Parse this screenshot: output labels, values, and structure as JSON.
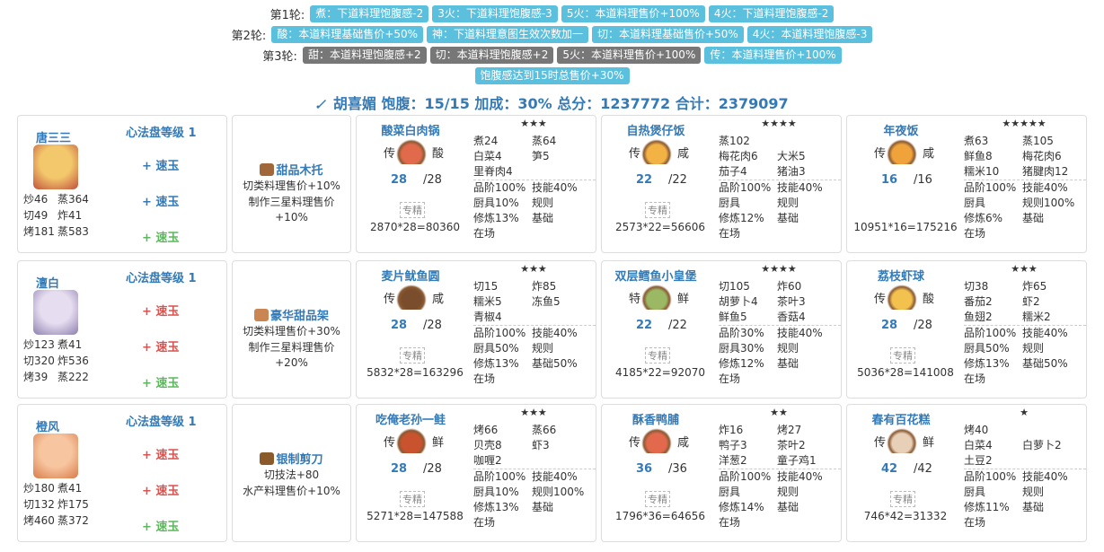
{
  "rounds": [
    {
      "label": "第1轮:",
      "tags": [
        {
          "text": "煮：下道料理饱腹感-2",
          "color": "blue"
        },
        {
          "text": "3火：下道料理饱腹感-3",
          "color": "blue"
        },
        {
          "text": "5火：本道料理售价+100%",
          "color": "blue"
        },
        {
          "text": "4火：下道料理饱腹感-2",
          "color": "blue"
        }
      ]
    },
    {
      "label": "第2轮:",
      "tags": [
        {
          "text": "酸：本道料理基础售价+50%",
          "color": "blue"
        },
        {
          "text": "神：下道料理意图生效次数加一",
          "color": "blue"
        },
        {
          "text": "切：本道料理基础售价+50%",
          "color": "blue"
        },
        {
          "text": "4火：本道料理饱腹感-3",
          "color": "blue"
        }
      ]
    },
    {
      "label": "第3轮:",
      "tags": [
        {
          "text": "甜：本道料理饱腹感+2",
          "color": "gray"
        },
        {
          "text": "切：本道料理饱腹感+2",
          "color": "gray"
        },
        {
          "text": "5火：本道料理售价+100%",
          "color": "gray"
        },
        {
          "text": "传：本道料理售价+100%",
          "color": "blue"
        }
      ]
    },
    {
      "label": "",
      "tags": [
        {
          "text": "饱腹感达到15时总售价+30%",
          "color": "blue"
        }
      ]
    }
  ],
  "summary": {
    "text": "胡喜媚 饱腹：15/15 加成：30% 总分：1237772 合计：2379097"
  },
  "rows": [
    {
      "chef": {
        "name": "唐三三",
        "xinfa": "心法盘等级 1",
        "stats": [
          "炒46",
          "蒸364",
          "切49",
          "炸41",
          "烤181",
          "蒸583"
        ],
        "yu": [
          {
            "text": "+ 速玉",
            "color": "blue"
          },
          {
            "text": "+ 速玉",
            "color": "blue"
          },
          {
            "text": "+ 速玉",
            "color": "green"
          }
        ]
      },
      "equip": {
        "name": "甜品木托",
        "effects": [
          "切类料理售价+10%",
          "制作三星料理售价+10%"
        ]
      },
      "dishes": [
        {
          "name": "酸菜白肉锅",
          "stars": "★★★",
          "source": "传",
          "taste": "酸",
          "qty": "28",
          "max": "/28",
          "note": "专精",
          "total": "2870*28=80360",
          "ingredients": [
            [
              "煮24",
              "蒸64"
            ],
            [
              "白菜4",
              "笋5"
            ],
            [
              "里脊肉4",
              ""
            ]
          ],
          "attrs": [
            [
              "品阶100%",
              "技能40%"
            ],
            [
              "厨具10%",
              "规则"
            ],
            [
              "修炼13%",
              "基础"
            ],
            [
              "在场",
              ""
            ]
          ]
        },
        {
          "name": "自热煲仔饭",
          "stars": "★★★★",
          "source": "传",
          "taste": "咸",
          "qty": "22",
          "max": "/22",
          "note": "专精",
          "total": "2573*22=56606",
          "ingredients": [
            [
              "蒸102",
              ""
            ],
            [
              "梅花肉6",
              "大米5"
            ],
            [
              "茄子4",
              "猪油3"
            ]
          ],
          "attrs": [
            [
              "品阶100%",
              "技能40%"
            ],
            [
              "厨具",
              "规则"
            ],
            [
              "修炼12%",
              "基础"
            ],
            [
              "在场",
              ""
            ]
          ]
        },
        {
          "name": "年夜饭",
          "stars": "★★★★★",
          "source": "传",
          "taste": "咸",
          "qty": "16",
          "max": "/16",
          "note": "",
          "total": "10951*16=175216",
          "ingredients": [
            [
              "煮63",
              "蒸105"
            ],
            [
              "鲜鱼8",
              "梅花肉6"
            ],
            [
              "糯米10",
              "猪腱肉12"
            ]
          ],
          "attrs": [
            [
              "品阶100%",
              "技能40%"
            ],
            [
              "厨具",
              "规则100%"
            ],
            [
              "修炼6%",
              "基础"
            ],
            [
              "在场",
              ""
            ]
          ]
        }
      ]
    },
    {
      "chef": {
        "name": "澶白",
        "xinfa": "心法盘等级 1",
        "stats": [
          "炒123",
          "煮41",
          "切320",
          "炸536",
          "烤39",
          "蒸222"
        ],
        "yu": [
          {
            "text": "+ 速玉",
            "color": "red"
          },
          {
            "text": "+ 速玉",
            "color": "red"
          },
          {
            "text": "+ 速玉",
            "color": "green"
          }
        ]
      },
      "equip": {
        "name": "豪华甜品架",
        "effects": [
          "切类料理售价+30%",
          "制作三星料理售价+20%"
        ]
      },
      "dishes": [
        {
          "name": "麦片鱿鱼圆",
          "stars": "★★★",
          "source": "传",
          "taste": "咸",
          "qty": "28",
          "max": "/28",
          "note": "专精",
          "total": "5832*28=163296",
          "ingredients": [
            [
              "切15",
              "炸85"
            ],
            [
              "糯米5",
              "冻鱼5"
            ],
            [
              "青椒4",
              ""
            ]
          ],
          "attrs": [
            [
              "品阶100%",
              "技能40%"
            ],
            [
              "厨具50%",
              "规则"
            ],
            [
              "修炼13%",
              "基础50%"
            ],
            [
              "在场",
              ""
            ]
          ]
        },
        {
          "name": "双层鳕鱼小皇堡",
          "stars": "★★★★",
          "source": "特",
          "taste": "鲜",
          "qty": "22",
          "max": "/22",
          "note": "专精",
          "total": "4185*22=92070",
          "ingredients": [
            [
              "切105",
              "炸60"
            ],
            [
              "胡萝卜4",
              "茶叶3"
            ],
            [
              "鲜鱼5",
              "香菇4"
            ]
          ],
          "attrs": [
            [
              "品阶30%",
              "技能40%"
            ],
            [
              "厨具30%",
              "规则"
            ],
            [
              "修炼12%",
              "基础"
            ],
            [
              "在场",
              ""
            ]
          ]
        },
        {
          "name": "荔枝虾球",
          "stars": "★★★",
          "source": "传",
          "taste": "酸",
          "qty": "28",
          "max": "/28",
          "note": "专精",
          "total": "5036*28=141008",
          "ingredients": [
            [
              "切38",
              "炸65"
            ],
            [
              "番茄2",
              "虾2"
            ],
            [
              "鱼翅2",
              "糯米2"
            ]
          ],
          "attrs": [
            [
              "品阶100%",
              "技能40%"
            ],
            [
              "厨具50%",
              "规则"
            ],
            [
              "修炼13%",
              "基础50%"
            ],
            [
              "在场",
              ""
            ]
          ]
        }
      ]
    },
    {
      "chef": {
        "name": "橙风",
        "xinfa": "心法盘等级 1",
        "stats": [
          "炒180",
          "煮41",
          "切132",
          "炸175",
          "烤460",
          "蒸372"
        ],
        "yu": [
          {
            "text": "+ 速玉",
            "color": "red"
          },
          {
            "text": "+ 速玉",
            "color": "red"
          },
          {
            "text": "+ 速玉",
            "color": "green"
          }
        ]
      },
      "equip": {
        "name": "银制剪刀",
        "effects": [
          "切技法+80",
          "水产料理售价+10%"
        ]
      },
      "dishes": [
        {
          "name": "吃俺老孙一鲑",
          "stars": "★★★",
          "source": "传",
          "taste": "鲜",
          "qty": "28",
          "max": "/28",
          "note": "专精",
          "total": "5271*28=147588",
          "ingredients": [
            [
              "烤66",
              "蒸66"
            ],
            [
              "贝壳8",
              "虾3"
            ],
            [
              "咖喱2",
              ""
            ]
          ],
          "attrs": [
            [
              "品阶100%",
              "技能40%"
            ],
            [
              "厨具10%",
              "规则100%"
            ],
            [
              "修炼13%",
              "基础"
            ],
            [
              "在场",
              ""
            ]
          ]
        },
        {
          "name": "酥香鸭脯",
          "stars": "★★",
          "source": "传",
          "taste": "咸",
          "qty": "36",
          "max": "/36",
          "note": "专精",
          "total": "1796*36=64656",
          "ingredients": [
            [
              "炸16",
              "烤27"
            ],
            [
              "鸭子3",
              "茶叶2"
            ],
            [
              "洋葱2",
              "童子鸡1"
            ]
          ],
          "attrs": [
            [
              "品阶100%",
              "技能40%"
            ],
            [
              "厨具",
              "规则"
            ],
            [
              "修炼14%",
              "基础"
            ],
            [
              "在场",
              ""
            ]
          ]
        },
        {
          "name": "春有百花糕",
          "stars": "★",
          "source": "传",
          "taste": "鲜",
          "qty": "42",
          "max": "/42",
          "note": "专精",
          "total": "746*42=31332",
          "ingredients": [
            [
              "烤40",
              ""
            ],
            [
              "白菜4",
              "白萝卜2"
            ],
            [
              "土豆2",
              ""
            ]
          ],
          "attrs": [
            [
              "品阶100%",
              "技能40%"
            ],
            [
              "厨具",
              "规则"
            ],
            [
              "修炼11%",
              "基础"
            ],
            [
              "在场",
              ""
            ]
          ]
        }
      ]
    }
  ]
}
